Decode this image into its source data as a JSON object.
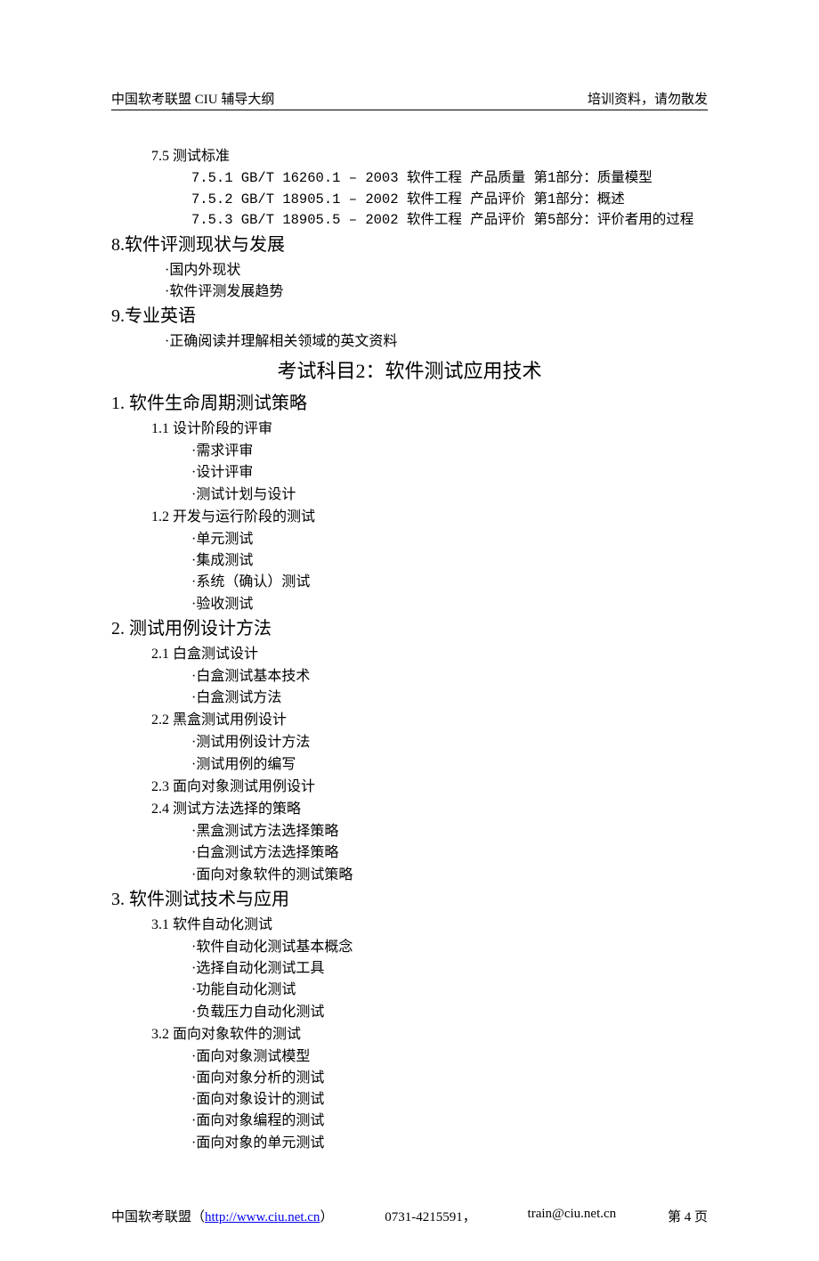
{
  "header": {
    "left": "中国软考联盟 CIU 辅导大纲",
    "right": "培训资料，请勿散发"
  },
  "s7_5_title": "7.5 测试标准",
  "s7_5_items": [
    "7.5.1 GB/T 16260.1 – 2003 软件工程 产品质量 第1部分：质量模型",
    "7.5.2 GB/T 18905.1 – 2002 软件工程 产品评价 第1部分：概述",
    "7.5.3 GB/T 18905.5 – 2002 软件工程 产品评价 第5部分：评价者用的过程"
  ],
  "s8_title": "8.软件评测现状与发展",
  "s8_items": [
    "·国内外现状",
    "·软件评测发展趋势"
  ],
  "s9_title": "9.专业英语",
  "s9_items": [
    "·正确阅读并理解相关领域的英文资料"
  ],
  "subject2_title": "考试科目2：软件测试应用技术",
  "s1_title": "1. 软件生命周期测试策略",
  "s1_1_title": "1.1 设计阶段的评审",
  "s1_1_items": [
    "·需求评审",
    "·设计评审",
    "·测试计划与设计"
  ],
  "s1_2_title": "1.2 开发与运行阶段的测试",
  "s1_2_items": [
    "·单元测试",
    "·集成测试",
    "·系统（确认）测试",
    "·验收测试"
  ],
  "s2_title": "2. 测试用例设计方法",
  "s2_1_title": "2.1 白盒测试设计",
  "s2_1_items": [
    "·白盒测试基本技术",
    "·白盒测试方法"
  ],
  "s2_2_title": "2.2 黑盒测试用例设计",
  "s2_2_items": [
    "·测试用例设计方法",
    "·测试用例的编写"
  ],
  "s2_3_title": "2.3 面向对象测试用例设计",
  "s2_4_title": "2.4 测试方法选择的策略",
  "s2_4_items": [
    "·黑盒测试方法选择策略",
    "·白盒测试方法选择策略",
    "·面向对象软件的测试策略"
  ],
  "s3_title": "3. 软件测试技术与应用",
  "s3_1_title": "3.1 软件自动化测试",
  "s3_1_items": [
    "·软件自动化测试基本概念",
    "·选择自动化测试工具",
    "·功能自动化测试",
    "·负载压力自动化测试"
  ],
  "s3_2_title": "3.2 面向对象软件的测试",
  "s3_2_items": [
    "·面向对象测试模型",
    "·面向对象分析的测试",
    "·面向对象设计的测试",
    "·面向对象编程的测试",
    "·面向对象的单元测试"
  ],
  "footer": {
    "org": "中国软考联盟（",
    "link_text": "http://www.ciu.net.cn",
    "org_close": "）",
    "phone": "0731-4215591，",
    "email": "train@ciu.net.cn",
    "page": "第 4 页"
  }
}
